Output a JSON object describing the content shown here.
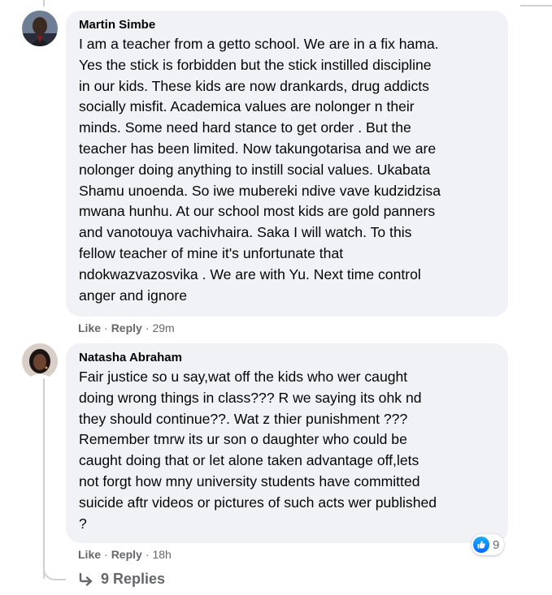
{
  "comments": [
    {
      "author": "Martin Simbe",
      "text": "I am a teacher from a getto school. We are in a fix hama.\nYes the stick is forbidden but the stick instilled discipline\nin our kids. These kids are now drankards, drug addicts\nsocially misfit. Academica values are nolonger n their\nminds. Some need hard stance to get order . But the\nteacher has been limited. Now takungotarisa and we are\nnolonger doing anything to instill social values. Ukabata\nShamu unoenda. So iwe mubereki ndive vave kudzidzisa\nmwana hunhu. At our school most kids are gold panners\nand vanotouya vachivhaira. Saka I will watch. To this\nfellow teacher of mine it's unfortunate that\nndokwazvazosvika . We are with Yu. Next time control\nanger and ignore",
      "like_label": "Like",
      "reply_label": "Reply",
      "time": "29m"
    },
    {
      "author": "Natasha Abraham",
      "text": "Fair justice so u say,wat off the kids who wer caught\ndoing wrong things in class??? R we saying its ohk nd\nthey should continue??. Wat z thier punishment ???\nRemember tmrw its ur son o daughter who could be\ncaught doing that or let alone taken advantage off,lets\nnot forgt how mny university students have committed\nsuicide aftr videos or pictures of such acts wer published\n?",
      "like_label": "Like",
      "reply_label": "Reply",
      "time": "18h",
      "reaction_icon": "thumbs-up-icon",
      "reaction_count": "9"
    }
  ],
  "replies_label": "9 Replies",
  "colors": {
    "bubble": "#f0f2f5",
    "muted": "#65676b",
    "like_blue": "#0866ff"
  }
}
